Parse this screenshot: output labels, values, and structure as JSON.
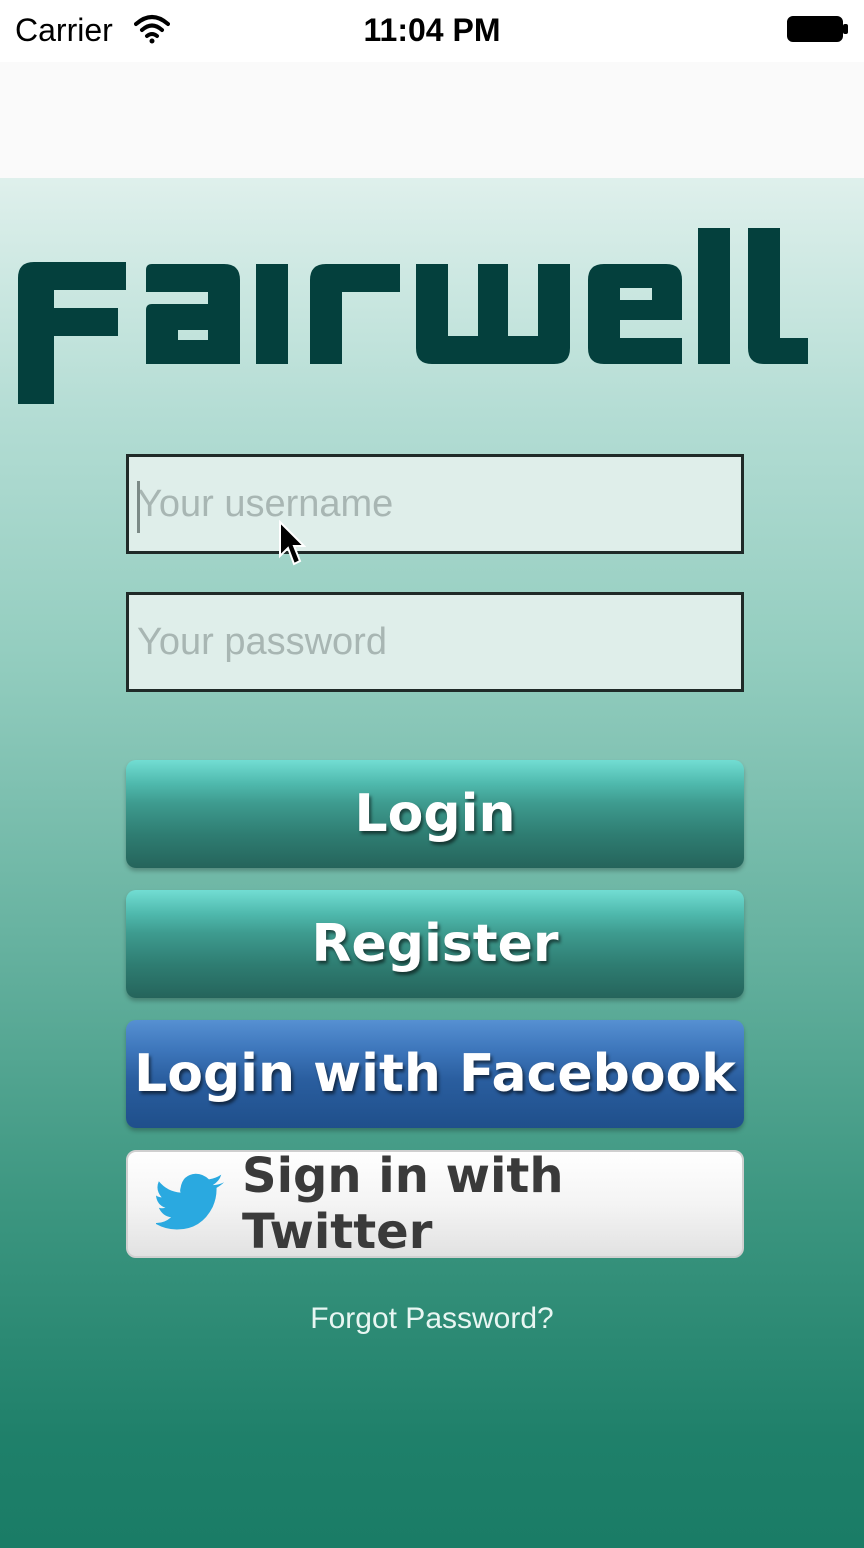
{
  "status_bar": {
    "carrier": "Carrier",
    "time": "11:04 PM",
    "wifi_icon": "wifi-icon",
    "battery_icon": "battery-icon"
  },
  "logo": {
    "text": "fairwell",
    "color": "#04403d"
  },
  "form": {
    "username_placeholder": "Your username",
    "username_value": "",
    "password_placeholder": "Your password",
    "password_value": ""
  },
  "buttons": {
    "login": "Login",
    "register": "Register",
    "facebook": "Login with Facebook",
    "twitter": "Sign in with Twitter",
    "twitter_icon": "twitter-bird-icon"
  },
  "links": {
    "forgot_password": "Forgot Password?"
  },
  "colors": {
    "teal_button": "#3e9b8f",
    "facebook_blue": "#2a5e9f",
    "twitter_blue": "#2aa9e0",
    "background_bottom": "#1a7c66"
  }
}
